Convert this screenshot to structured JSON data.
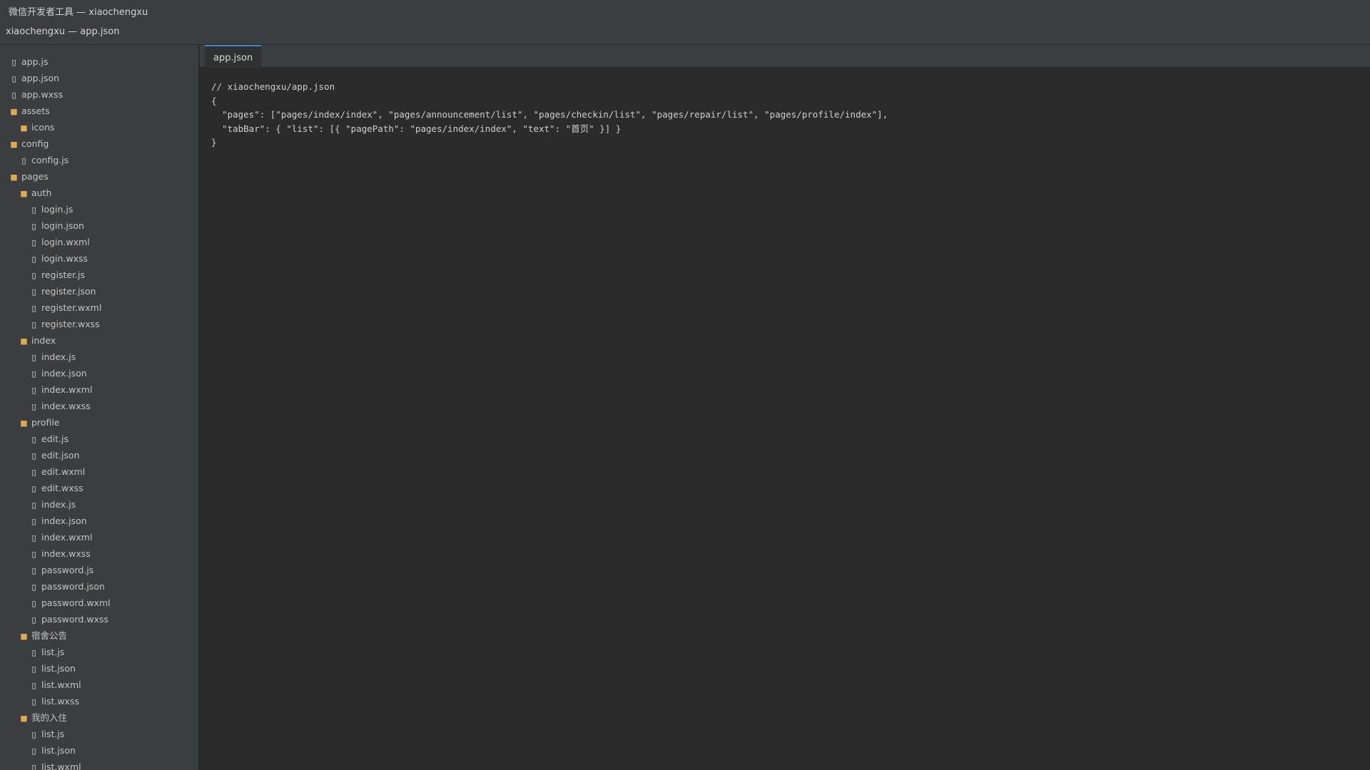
{
  "titlebar": {
    "app_title": "微信开发者工具 — xiaochengxu",
    "window_title": "xiaochengxu — app.json"
  },
  "sidebar": {
    "items": [
      {
        "label": "app.js",
        "type": "file",
        "depth": 0
      },
      {
        "label": "app.json",
        "type": "file",
        "depth": 0
      },
      {
        "label": "app.wxss",
        "type": "file",
        "depth": 0
      },
      {
        "label": "assets",
        "type": "folder",
        "depth": 0
      },
      {
        "label": "icons",
        "type": "folder",
        "depth": 1
      },
      {
        "label": "config",
        "type": "folder",
        "depth": 0
      },
      {
        "label": "config.js",
        "type": "file",
        "depth": 1
      },
      {
        "label": "pages",
        "type": "folder",
        "depth": 0
      },
      {
        "label": "auth",
        "type": "folder",
        "depth": 1
      },
      {
        "label": "login.js",
        "type": "file",
        "depth": 2
      },
      {
        "label": "login.json",
        "type": "file",
        "depth": 2
      },
      {
        "label": "login.wxml",
        "type": "file",
        "depth": 2
      },
      {
        "label": "login.wxss",
        "type": "file",
        "depth": 2
      },
      {
        "label": "register.js",
        "type": "file",
        "depth": 2
      },
      {
        "label": "register.json",
        "type": "file",
        "depth": 2
      },
      {
        "label": "register.wxml",
        "type": "file",
        "depth": 2
      },
      {
        "label": "register.wxss",
        "type": "file",
        "depth": 2
      },
      {
        "label": "index",
        "type": "folder",
        "depth": 1
      },
      {
        "label": "index.js",
        "type": "file",
        "depth": 2
      },
      {
        "label": "index.json",
        "type": "file",
        "depth": 2
      },
      {
        "label": "index.wxml",
        "type": "file",
        "depth": 2
      },
      {
        "label": "index.wxss",
        "type": "file",
        "depth": 2
      },
      {
        "label": "profile",
        "type": "folder",
        "depth": 1
      },
      {
        "label": "edit.js",
        "type": "file",
        "depth": 2
      },
      {
        "label": "edit.json",
        "type": "file",
        "depth": 2
      },
      {
        "label": "edit.wxml",
        "type": "file",
        "depth": 2
      },
      {
        "label": "edit.wxss",
        "type": "file",
        "depth": 2
      },
      {
        "label": "index.js",
        "type": "file",
        "depth": 2
      },
      {
        "label": "index.json",
        "type": "file",
        "depth": 2
      },
      {
        "label": "index.wxml",
        "type": "file",
        "depth": 2
      },
      {
        "label": "index.wxss",
        "type": "file",
        "depth": 2
      },
      {
        "label": "password.js",
        "type": "file",
        "depth": 2
      },
      {
        "label": "password.json",
        "type": "file",
        "depth": 2
      },
      {
        "label": "password.wxml",
        "type": "file",
        "depth": 2
      },
      {
        "label": "password.wxss",
        "type": "file",
        "depth": 2
      },
      {
        "label": "宿舍公告",
        "type": "folder",
        "depth": 1
      },
      {
        "label": "list.js",
        "type": "file",
        "depth": 2
      },
      {
        "label": "list.json",
        "type": "file",
        "depth": 2
      },
      {
        "label": "list.wxml",
        "type": "file",
        "depth": 2
      },
      {
        "label": "list.wxss",
        "type": "file",
        "depth": 2
      },
      {
        "label": "我的入住",
        "type": "folder",
        "depth": 1
      },
      {
        "label": "list.js",
        "type": "file",
        "depth": 2
      },
      {
        "label": "list.json",
        "type": "file",
        "depth": 2
      },
      {
        "label": "list.wxml",
        "type": "file",
        "depth": 2
      }
    ]
  },
  "editor": {
    "tabs": [
      {
        "label": "app.json",
        "active": true
      }
    ],
    "code_lines": [
      "// xiaochengxu/app.json",
      "{",
      "  \"pages\": [\"pages/index/index\", \"pages/announcement/list\", \"pages/checkin/list\", \"pages/repair/list\", \"pages/profile/index\"],",
      "  \"tabBar\": { \"list\": [{ \"pagePath\": \"pages/index/index\", \"text\": \"首页\" }] }",
      "}"
    ]
  },
  "colors": {
    "chrome": "#3b3e41",
    "editor_bg": "#2b2b2b",
    "tab_accent": "#3c8ad8",
    "folder_icon": "#e0a94a"
  }
}
